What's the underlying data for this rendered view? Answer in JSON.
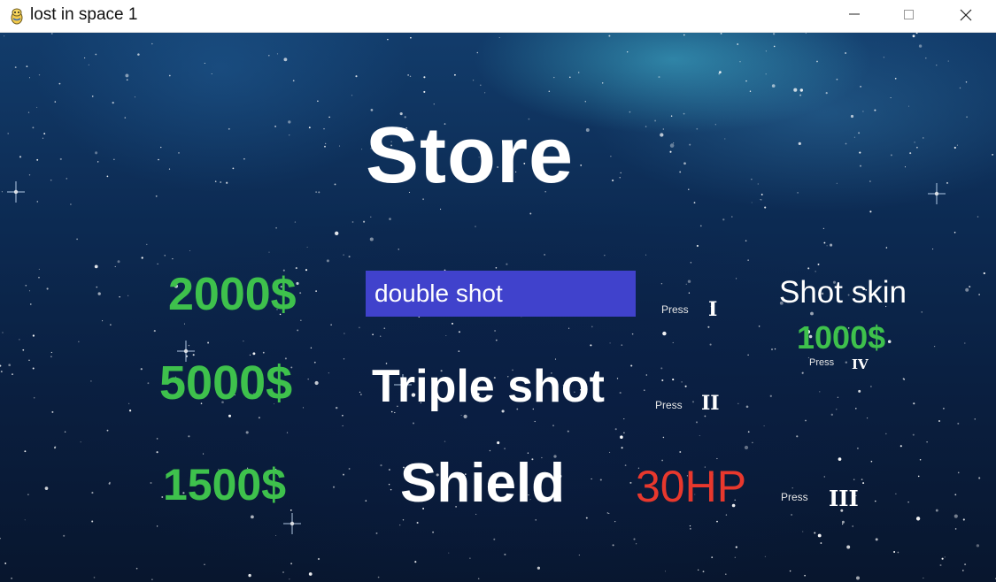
{
  "window": {
    "title": "lost in space 1",
    "icon": "pygame-snake-icon",
    "controls": [
      "minimize-icon",
      "maximize-icon",
      "close-icon"
    ]
  },
  "store": {
    "title": "Store",
    "items": [
      {
        "price": "2000$",
        "name": "double shot",
        "press_label": "Press",
        "key": "I",
        "selected": true
      },
      {
        "price": "5000$",
        "name": "Triple shot",
        "press_label": "Press",
        "key": "II",
        "selected": false
      },
      {
        "price": "1500$",
        "name": "Shield",
        "extra": "30HP",
        "press_label": "Press",
        "key": "III",
        "selected": false
      }
    ],
    "skin": {
      "name": "Shot skin",
      "price": "1000$",
      "press_label": "Press",
      "key": "IV"
    }
  },
  "colors": {
    "price": "#3ec14c",
    "hp": "#e8382d",
    "selection": "#4042cc",
    "text": "#ffffff"
  }
}
